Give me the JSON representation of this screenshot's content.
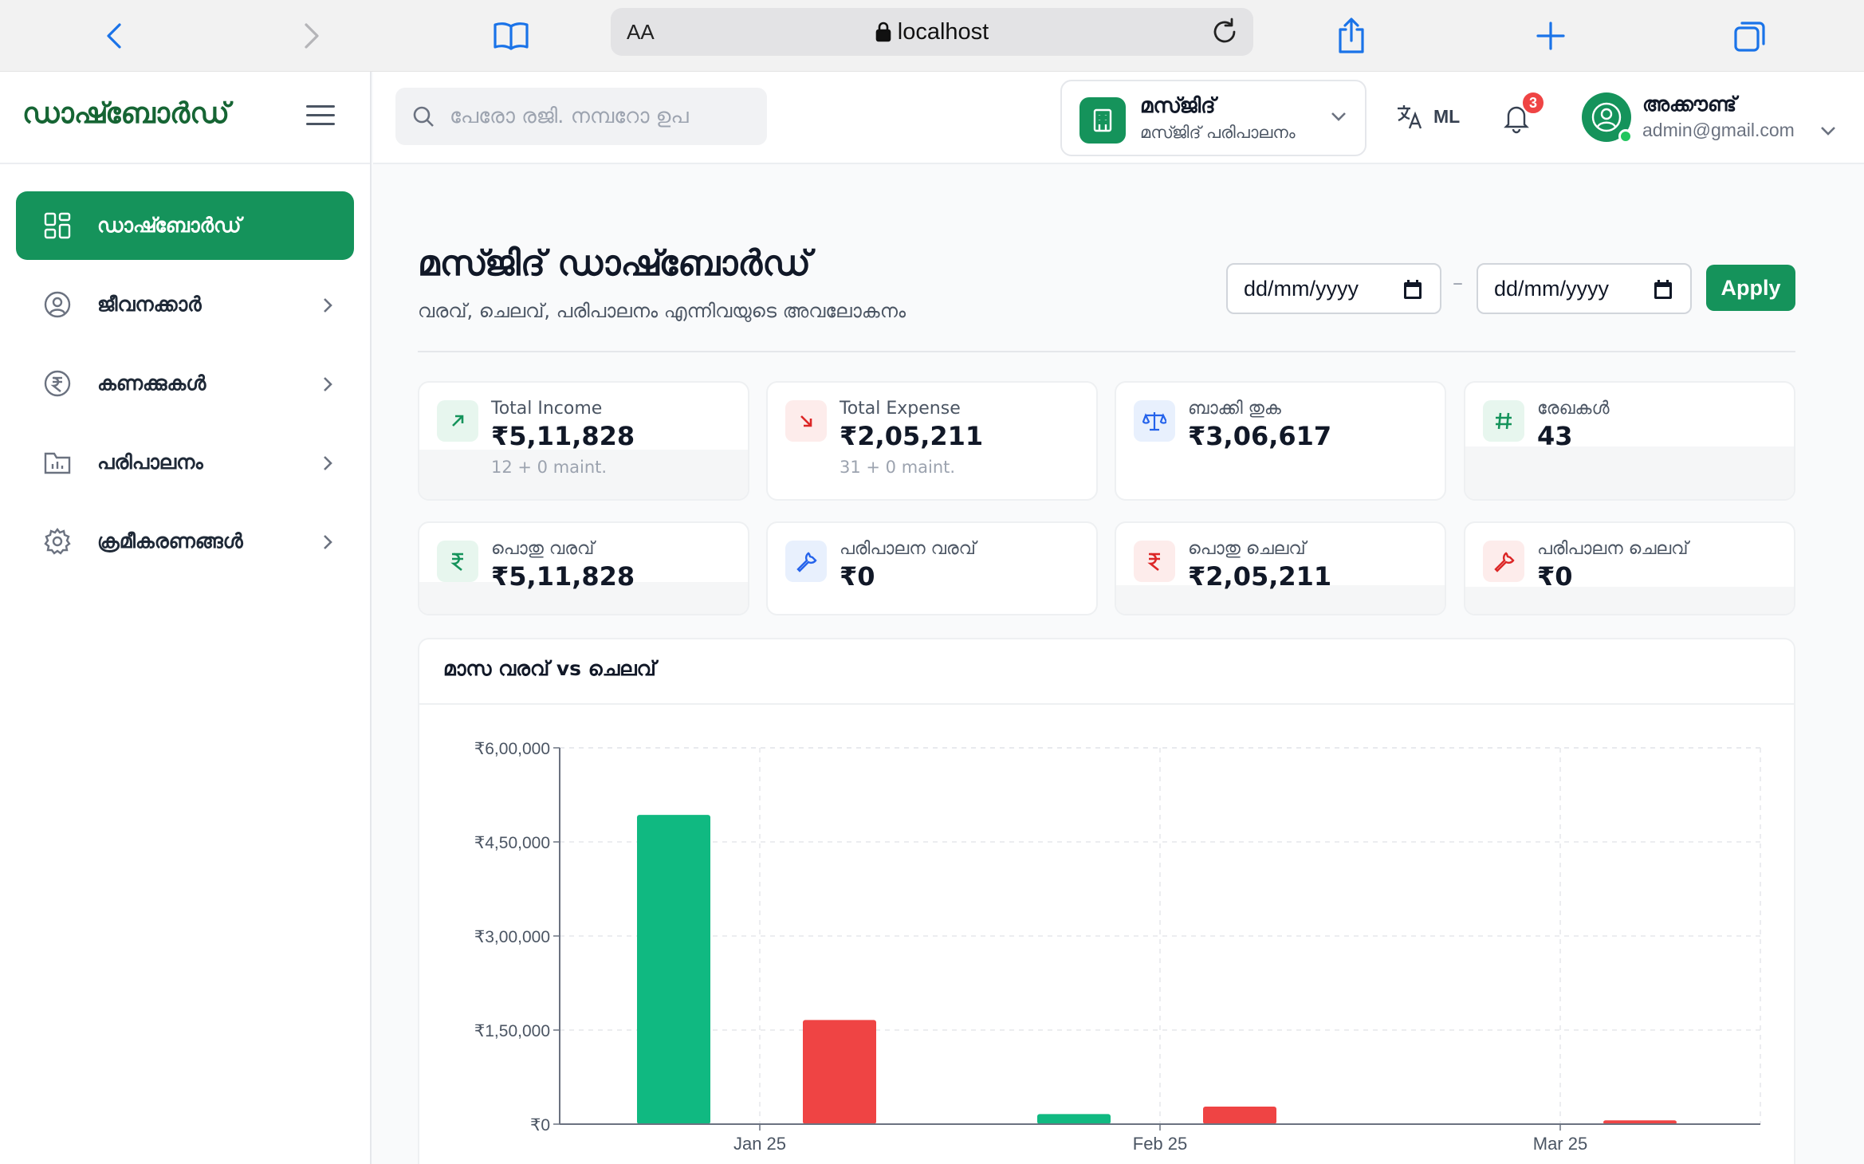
{
  "browser": {
    "text_size_label": "AA",
    "url_host": "localhost"
  },
  "sidebar": {
    "brand": "ഡാഷ്ബോർഡ്",
    "items": [
      {
        "label": "ഡാഷ്ബോർഡ്",
        "icon": "grid-icon",
        "active": true
      },
      {
        "label": "ജീവനക്കാർ",
        "icon": "user-circle-icon",
        "active": false
      },
      {
        "label": "കണക്കുകൾ",
        "icon": "rupee-circle-icon",
        "active": false
      },
      {
        "label": "പരിപാലനം",
        "icon": "folder-chart-icon",
        "active": false
      },
      {
        "label": "ക്രമീകരണങ്ങൾ",
        "icon": "gear-icon",
        "active": false
      }
    ]
  },
  "header": {
    "search_placeholder": "പേരോ രജി. നമ്പറോ ഉപ",
    "org_name": "മസ്ജിദ്",
    "org_sub": "മസ്ജിദ് പരിപാലനം",
    "lang": "ML",
    "notification_count": "3",
    "account_name": "അക്കൗണ്ട്",
    "account_email": "admin@gmail.com"
  },
  "main": {
    "title": "മസ്ജിദ് ഡാഷ്ബോർഡ്",
    "subtitle": "വരവ്, ചെലവ്, പരിപാലനം എന്നിവയുടെ അവലോകനം",
    "date_from": "dd/mm/yyyy",
    "date_to": "dd/mm/yyyy",
    "date_sep": "–",
    "apply_label": "Apply"
  },
  "stats": [
    {
      "label": "Total Income",
      "value": "₹5,11,828",
      "note": "12 + 0 maint.",
      "icon": "arrow-up-right-icon",
      "color": "#15935b"
    },
    {
      "label": "Total Expense",
      "value": "₹2,05,211",
      "note": "31 + 0 maint.",
      "icon": "arrow-down-right-icon",
      "color": "#dc2626"
    },
    {
      "label": "ബാക്കി തുക",
      "value": "₹3,06,617",
      "note": "",
      "icon": "scale-icon",
      "color": "#2563eb"
    },
    {
      "label": "രേഖകൾ",
      "value": "43",
      "note": "",
      "icon": "hash-icon",
      "color": "#15935b"
    },
    {
      "label": "പൊതു വരവ്",
      "value": "₹5,11,828",
      "note": "",
      "icon": "rupee-icon",
      "color": "#15935b"
    },
    {
      "label": "പരിപാലന വരവ്",
      "value": "₹0",
      "note": "",
      "icon": "wrench-icon",
      "color": "#2563eb"
    },
    {
      "label": "പൊതു ചെലവ്",
      "value": "₹2,05,211",
      "note": "",
      "icon": "rupee-icon",
      "color": "#dc2626"
    },
    {
      "label": "പരിപാലന ചെലവ്",
      "value": "₹0",
      "note": "",
      "icon": "wrench-icon",
      "color": "#dc2626"
    }
  ],
  "chart_data": {
    "type": "bar",
    "title": "മാസ വരവ് vs ചെലവ്",
    "categories": [
      "Jan 25",
      "Feb 25",
      "Mar 25"
    ],
    "series": [
      {
        "values": [
          493000,
          16000,
          0
        ],
        "color": "#10b981"
      },
      {
        "values": [
          166000,
          28000,
          6000
        ],
        "color": "#ef4444"
      }
    ],
    "ylim": [
      0,
      600000
    ],
    "yticks": [
      {
        "value": 0,
        "label": "₹0"
      },
      {
        "value": 150000,
        "label": "₹1,50,000"
      },
      {
        "value": 300000,
        "label": "₹3,00,000"
      },
      {
        "value": 450000,
        "label": "₹4,50,000"
      },
      {
        "value": 600000,
        "label": "₹6,00,000"
      }
    ],
    "grid": true
  }
}
